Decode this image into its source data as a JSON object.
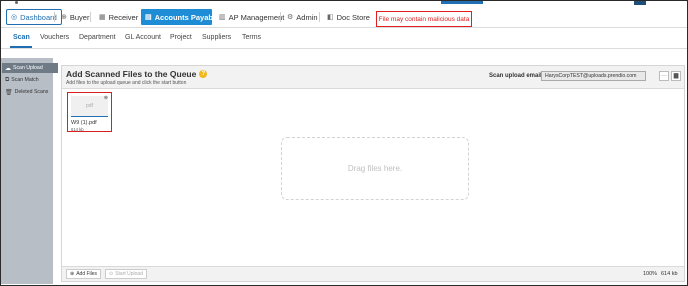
{
  "top_nav": {
    "items": [
      {
        "label": "Dashboard",
        "icon": "dashboard-icon"
      },
      {
        "label": "Buyer",
        "icon": "buyer-icon"
      },
      {
        "label": "Receiver",
        "icon": "calendar-icon"
      },
      {
        "label": "Accounts Payable",
        "icon": "document-icon"
      },
      {
        "label": "AP Management",
        "icon": "invoice-icon"
      },
      {
        "label": "Admin",
        "icon": "gear-icon"
      },
      {
        "label": "Doc Store",
        "icon": "doc-store-icon"
      }
    ],
    "active": "Accounts Payable",
    "accent_color": "#1f8dd6"
  },
  "warning": {
    "text": "File may contain malicious data",
    "color": "#e02020"
  },
  "sub_nav": {
    "items": [
      "Scan",
      "Vouchers",
      "Department",
      "GL Account",
      "Project",
      "Suppliers",
      "Terms"
    ],
    "active": "Scan"
  },
  "sidebar": {
    "items": [
      {
        "label": "Scan Upload",
        "icon": "cloud-upload-icon",
        "active": true
      },
      {
        "label": "Scan Match",
        "icon": "match-icon",
        "active": false
      },
      {
        "label": "Deleted Scans",
        "icon": "trash-icon",
        "active": false
      }
    ]
  },
  "panel": {
    "title": "Add Scanned Files to the Queue",
    "help": "?",
    "subtitle": "Add files to the upload queue and click the start button",
    "email_label": "Scan upload email",
    "email_value": "HarysCorpTEST@uploads.prendio.com",
    "file": {
      "thumb_label": "pdf",
      "name": "W9 (1).pdf",
      "size": "614 kb",
      "close": "⊗"
    },
    "dropzone_text": "Drag files here.",
    "footer": {
      "add_label": "Add Files",
      "start_label": "Start Upload",
      "percent": "100%",
      "total_size": "614 kb"
    }
  }
}
